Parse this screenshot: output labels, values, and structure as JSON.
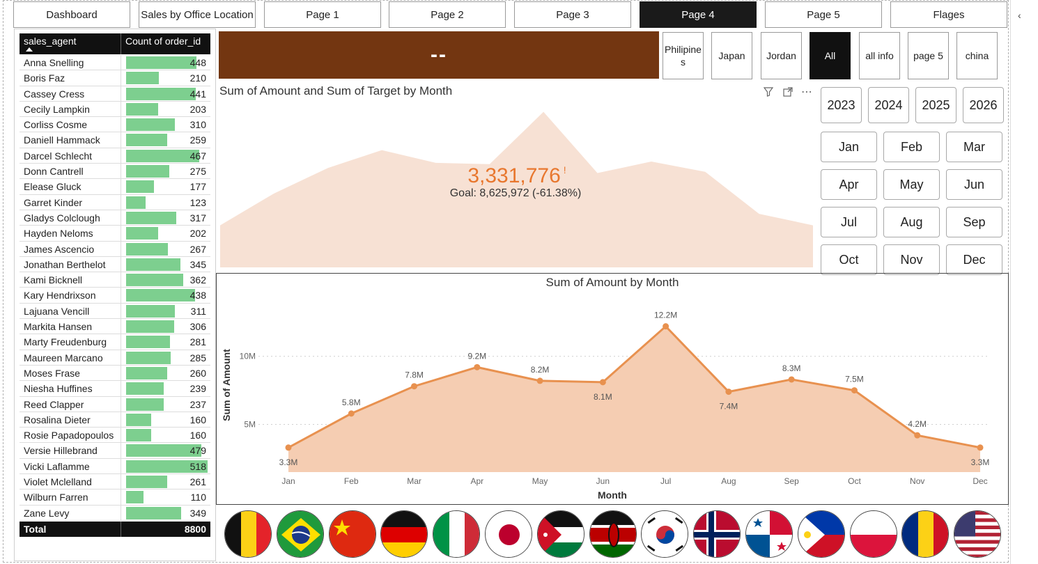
{
  "nav": {
    "tabs": [
      {
        "label": "Dashboard",
        "active": false
      },
      {
        "label": "Sales by Office Location",
        "active": false
      },
      {
        "label": "Page 1",
        "active": false
      },
      {
        "label": "Page 2",
        "active": false
      },
      {
        "label": "Page 3",
        "active": false
      },
      {
        "label": "Page 4",
        "active": true
      },
      {
        "label": "Page 5",
        "active": false
      },
      {
        "label": "Flages",
        "active": false
      }
    ]
  },
  "table": {
    "col1": "sales_agent",
    "col2": "Count of order_id",
    "max_value": 518,
    "rows": [
      {
        "name": "Anna Snelling",
        "value": 448
      },
      {
        "name": "Boris Faz",
        "value": 210
      },
      {
        "name": "Cassey Cress",
        "value": 441
      },
      {
        "name": "Cecily Lampkin",
        "value": 203
      },
      {
        "name": "Corliss Cosme",
        "value": 310
      },
      {
        "name": "Daniell Hammack",
        "value": 259
      },
      {
        "name": "Darcel Schlecht",
        "value": 467
      },
      {
        "name": "Donn Cantrell",
        "value": 275
      },
      {
        "name": "Elease Gluck",
        "value": 177
      },
      {
        "name": "Garret Kinder",
        "value": 123
      },
      {
        "name": "Gladys Colclough",
        "value": 317
      },
      {
        "name": "Hayden Neloms",
        "value": 202
      },
      {
        "name": "James Ascencio",
        "value": 267
      },
      {
        "name": "Jonathan Berthelot",
        "value": 345
      },
      {
        "name": "Kami Bicknell",
        "value": 362
      },
      {
        "name": "Kary Hendrixson",
        "value": 438
      },
      {
        "name": "Lajuana Vencill",
        "value": 311
      },
      {
        "name": "Markita Hansen",
        "value": 306
      },
      {
        "name": "Marty Freudenburg",
        "value": 281
      },
      {
        "name": "Maureen Marcano",
        "value": 285
      },
      {
        "name": "Moses Frase",
        "value": 260
      },
      {
        "name": "Niesha Huffines",
        "value": 239
      },
      {
        "name": "Reed Clapper",
        "value": 237
      },
      {
        "name": "Rosalina Dieter",
        "value": 160
      },
      {
        "name": "Rosie Papadopoulos",
        "value": 160
      },
      {
        "name": "Versie Hillebrand",
        "value": 479
      },
      {
        "name": "Vicki Laflamme",
        "value": 518
      },
      {
        "name": "Violet Mclelland",
        "value": 261
      },
      {
        "name": "Wilburn Farren",
        "value": 110
      },
      {
        "name": "Zane Levy",
        "value": 349
      }
    ],
    "total_label": "Total",
    "total_value": "8800"
  },
  "banner": {
    "text": "--",
    "color": "#733611"
  },
  "filters": [
    {
      "label": "Philipines",
      "active": false
    },
    {
      "label": "Japan",
      "active": false
    },
    {
      "label": "Jordan",
      "active": false
    },
    {
      "label": "All",
      "active": true
    },
    {
      "label": "all info",
      "active": false
    },
    {
      "label": "page 5",
      "active": false
    },
    {
      "label": "china",
      "active": false
    }
  ],
  "years": [
    "2023",
    "2024",
    "2025",
    "2026"
  ],
  "months": [
    "Jan",
    "Feb",
    "Mar",
    "Apr",
    "May",
    "Jun",
    "Jul",
    "Aug",
    "Sep",
    "Oct",
    "Nov",
    "Dec"
  ],
  "kpi": {
    "title": "Sum of Amount and Sum of Target by Month",
    "value": "3,331,776",
    "alert": "!",
    "goal": "Goal: 8,625,972 (-61.38%)",
    "value_color": "#e8772e",
    "icons": [
      "filter-icon",
      "focus-mode-icon",
      "more-options-icon"
    ]
  },
  "chart_data": [
    {
      "type": "area",
      "title": "Sum of Amount and Sum of Target by Month",
      "x": [
        "Jan",
        "Feb",
        "Mar",
        "Apr",
        "May",
        "Jun",
        "Jul",
        "Aug",
        "Sep",
        "Oct",
        "Nov",
        "Dec"
      ],
      "series": [
        {
          "values": [
            3.3,
            5.8,
            7.8,
            9.2,
            8.2,
            8.1,
            12.2,
            7.4,
            8.3,
            7.5,
            4.2,
            3.3
          ]
        }
      ],
      "ylim": [
        0,
        13
      ],
      "fill_color": "#f7e1d4"
    },
    {
      "type": "line",
      "title": "Sum of Amount by Month",
      "xlabel": "Month",
      "ylabel": "Sum of Amount",
      "x": [
        "Jan",
        "Feb",
        "Mar",
        "Apr",
        "May",
        "Jun",
        "Jul",
        "Aug",
        "Sep",
        "Oct",
        "Nov",
        "Dec"
      ],
      "series": [
        {
          "values": [
            3.3,
            5.8,
            7.8,
            9.2,
            8.2,
            8.1,
            12.2,
            7.4,
            8.3,
            7.5,
            4.2,
            3.3
          ]
        }
      ],
      "labels": [
        "3.3M",
        "5.8M",
        "7.8M",
        "9.2M",
        "8.2M",
        "8.1M",
        "12.2M",
        "7.4M",
        "8.3M",
        "7.5M",
        "4.2M",
        "3.3M"
      ],
      "yticks": [
        {
          "value": 5,
          "label": "5M"
        },
        {
          "value": 10,
          "label": "10M"
        }
      ],
      "ylim": [
        1.5,
        13
      ],
      "grid": true,
      "line_color": "#e8914f",
      "fill_color": "#f5cdb2"
    }
  ],
  "flags": [
    "Belgium",
    "Brazil",
    "China",
    "Germany",
    "Italy",
    "Japan",
    "Jordan",
    "Kenya",
    "South Korea",
    "Norway",
    "Panama",
    "Philippines",
    "Poland",
    "Romania",
    "United States"
  ]
}
